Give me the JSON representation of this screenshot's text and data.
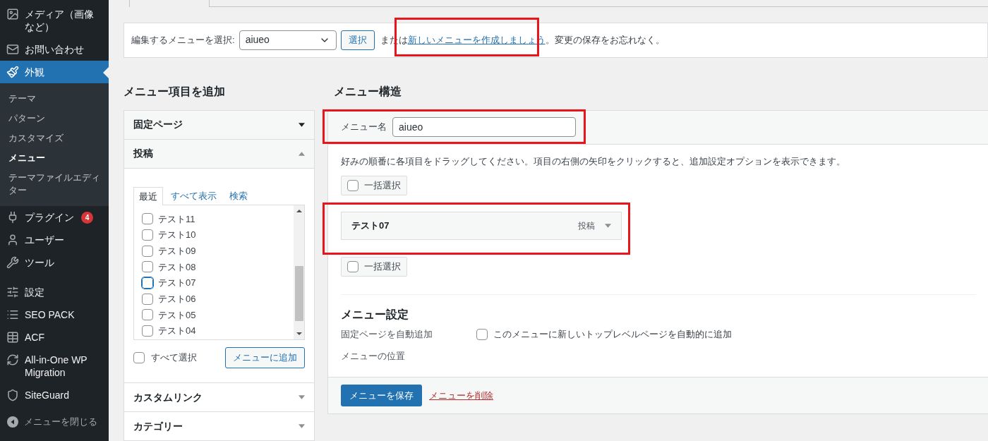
{
  "sidebar": {
    "items": [
      {
        "label": "メディア（画像など）",
        "selected": false
      },
      {
        "label": "お問い合わせ",
        "selected": false
      },
      {
        "label": "外観",
        "selected": true,
        "children": [
          {
            "label": "テーマ",
            "selected": false
          },
          {
            "label": "パターン",
            "selected": false
          },
          {
            "label": "カスタマイズ",
            "selected": false
          },
          {
            "label": "メニュー",
            "selected": true
          },
          {
            "label": "テーマファイルエディター",
            "selected": false
          }
        ]
      },
      {
        "label": "プラグイン",
        "selected": false,
        "badge": "4"
      },
      {
        "label": "ユーザー",
        "selected": false
      },
      {
        "label": "ツール",
        "selected": false
      },
      {
        "label": "設定",
        "selected": false
      },
      {
        "label": "SEO PACK",
        "selected": false
      },
      {
        "label": "ACF",
        "selected": false
      },
      {
        "label": "All-in-One WP Migration",
        "selected": false
      },
      {
        "label": "SiteGuard",
        "selected": false
      }
    ],
    "collapse": "メニューを閉じる"
  },
  "menu_picker": {
    "label": "編集するメニューを選択:",
    "value": "aiueo",
    "button": "選択",
    "text_before": "または",
    "link": "新しいメニューを作成しましょう",
    "text_after": "。変更の保存をお忘れなく。"
  },
  "add_items": {
    "heading": "メニュー項目を追加",
    "sections": [
      {
        "title": "固定ページ",
        "expanded": false
      },
      {
        "title": "投稿",
        "expanded": true,
        "tabs": [
          {
            "label": "最近",
            "selected": true
          },
          {
            "label": "すべて表示",
            "selected": false
          },
          {
            "label": "検索",
            "selected": false
          }
        ],
        "items": [
          {
            "label": "テスト11",
            "checked": false,
            "focused": false
          },
          {
            "label": "テスト10",
            "checked": false,
            "focused": false
          },
          {
            "label": "テスト09",
            "checked": false,
            "focused": false
          },
          {
            "label": "テスト08",
            "checked": false,
            "focused": false
          },
          {
            "label": "テスト07",
            "checked": false,
            "focused": true
          },
          {
            "label": "テスト06",
            "checked": false,
            "focused": false
          },
          {
            "label": "テスト05",
            "checked": false,
            "focused": false
          },
          {
            "label": "テスト04",
            "checked": false,
            "focused": false
          }
        ],
        "select_all": {
          "label": "すべて選択",
          "checked": false
        },
        "add_button": "メニューに追加"
      },
      {
        "title": "カスタムリンク",
        "expanded": false
      },
      {
        "title": "カテゴリー",
        "expanded": false
      }
    ]
  },
  "structure": {
    "heading": "メニュー構造",
    "name_label": "メニュー名",
    "name_value": "aiueo",
    "instructions": "好みの順番に各項目をドラッグしてください。項目の右側の矢印をクリックすると、追加設定オプションを表示できます。",
    "bulk_top": {
      "label": "一括選択",
      "checked": false
    },
    "items": [
      {
        "title": "テスト07",
        "type": "投稿"
      }
    ],
    "bulk_bottom": {
      "label": "一括選択",
      "checked": false
    },
    "settings_heading": "メニュー設定",
    "settings": [
      {
        "label": "固定ページを自動追加",
        "option": "このメニューに新しいトップレベルページを自動的に追加",
        "checked": false
      },
      {
        "label": "メニューの位置"
      }
    ],
    "save_button": "メニューを保存",
    "delete_link": "メニューを削除"
  }
}
